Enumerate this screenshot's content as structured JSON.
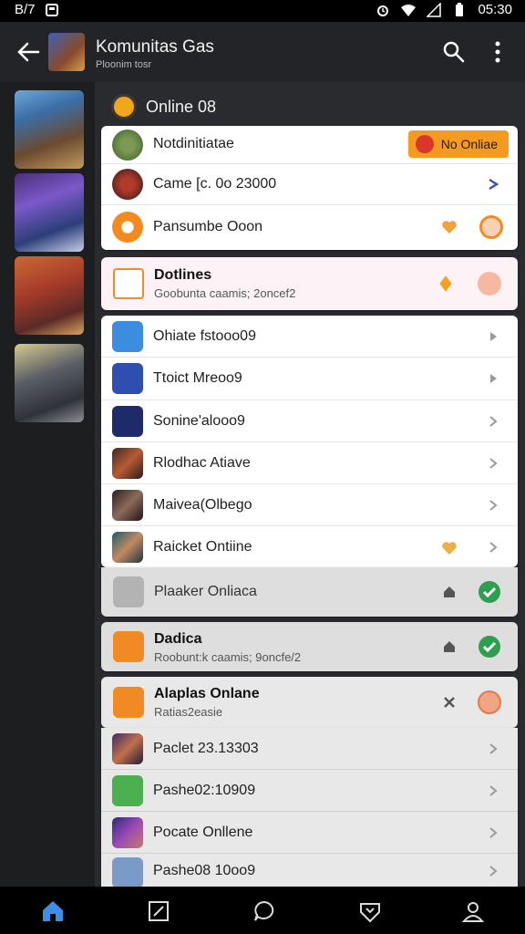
{
  "status_bar": {
    "left": "B/7",
    "time": "05:30"
  },
  "header": {
    "title": "Komunitas Gas",
    "subtitle": "Ploonim tosr"
  },
  "section": {
    "title": "Online 08"
  },
  "top_card": {
    "rows": [
      {
        "label": "Notdinitiatae",
        "pill": "No Onliae"
      },
      {
        "label": "Came  [c. 0o 23000"
      },
      {
        "label": "Pansumbe Ooon"
      }
    ]
  },
  "highlight_card": {
    "title": "Dotlines",
    "subtitle": "Goobunta caamis; 2oncef2"
  },
  "list": [
    {
      "label": "Ohiate fstooo09"
    },
    {
      "label": "Ttoict Mreoo9"
    },
    {
      "label": "Sonine'alooo9"
    },
    {
      "label": "Rlodhac Atiave"
    },
    {
      "label": "Maivea(Olbego"
    },
    {
      "label": "Raicket Ontiine"
    }
  ],
  "grey_row": {
    "label": "Plaaker Onliaca"
  },
  "dadica_card": {
    "title": "Dadica",
    "subtitle": "Roobunt:k caamis; 9oncfe/2"
  },
  "alaplas_card": {
    "title": "Alaplas Onlane",
    "subtitle": "Ratias2easie"
  },
  "bottom_list": [
    {
      "label": "Paclet 23.13303"
    },
    {
      "label": "Pashe02:10909"
    },
    {
      "label": "Pocate Onllene"
    },
    {
      "label": "Pashe08 10oo9"
    }
  ],
  "colors": {
    "accent_orange": "#f49a21",
    "header_bg": "#232427",
    "panel_bg": "#2a2b2e",
    "check_green": "#2e9e4f"
  }
}
